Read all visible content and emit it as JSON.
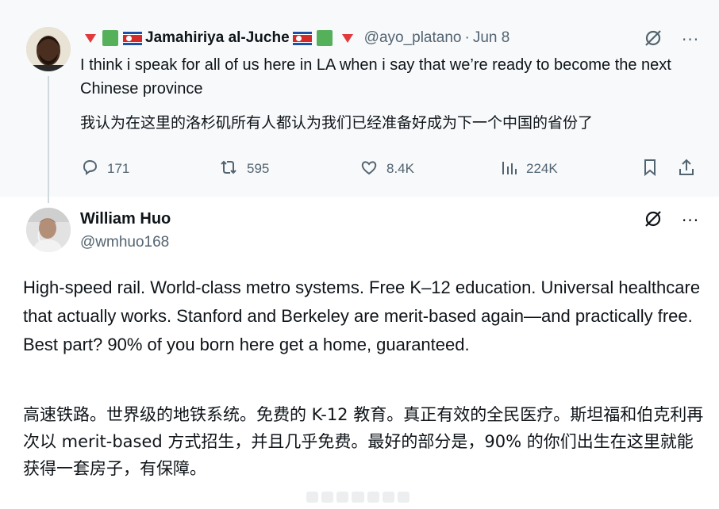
{
  "parent_post": {
    "display_name": "Jamahiriya al-Juche",
    "handle": "@ayo_platano",
    "date": "Jun 8",
    "text": "I think i speak for all of us here in LA when i say that we’re ready to become the next Chinese province",
    "text_translation": "我认为在这里的洛杉矶所有人都认为我们已经准备好成为下一个中国的省份了",
    "stats": {
      "replies": "171",
      "reposts": "595",
      "likes": "8.4K",
      "views": "224K"
    },
    "more": "···"
  },
  "reply_post": {
    "display_name": "William Huo",
    "handle": "@wmhuo168",
    "text": "High-speed rail. World-class metro systems. Free K–12 education. Universal healthcare that actually works. Stanford and Berkeley are merit-based again—and practically free. Best part? 90% of you born here get a home, guaranteed.",
    "text_translation": "高速铁路。世界级的地铁系统。免费的 K-12 教育。真正有效的全民医疗。斯坦福和伯克利再次以 merit-based 方式招生，并且几乎免费。最好的部分是，90% 的你们出生在这里就能获得一套房子，有保障。"
  },
  "colors": {
    "accent_red": "#e03a3e",
    "accent_green": "#55b05a",
    "muted_text": "#536471",
    "thread_line": "#cfd9de"
  },
  "icons": [
    "reply-icon",
    "repost-icon",
    "like-icon",
    "views-icon",
    "bookmark-icon",
    "share-icon",
    "grok-icon",
    "more-icon"
  ]
}
